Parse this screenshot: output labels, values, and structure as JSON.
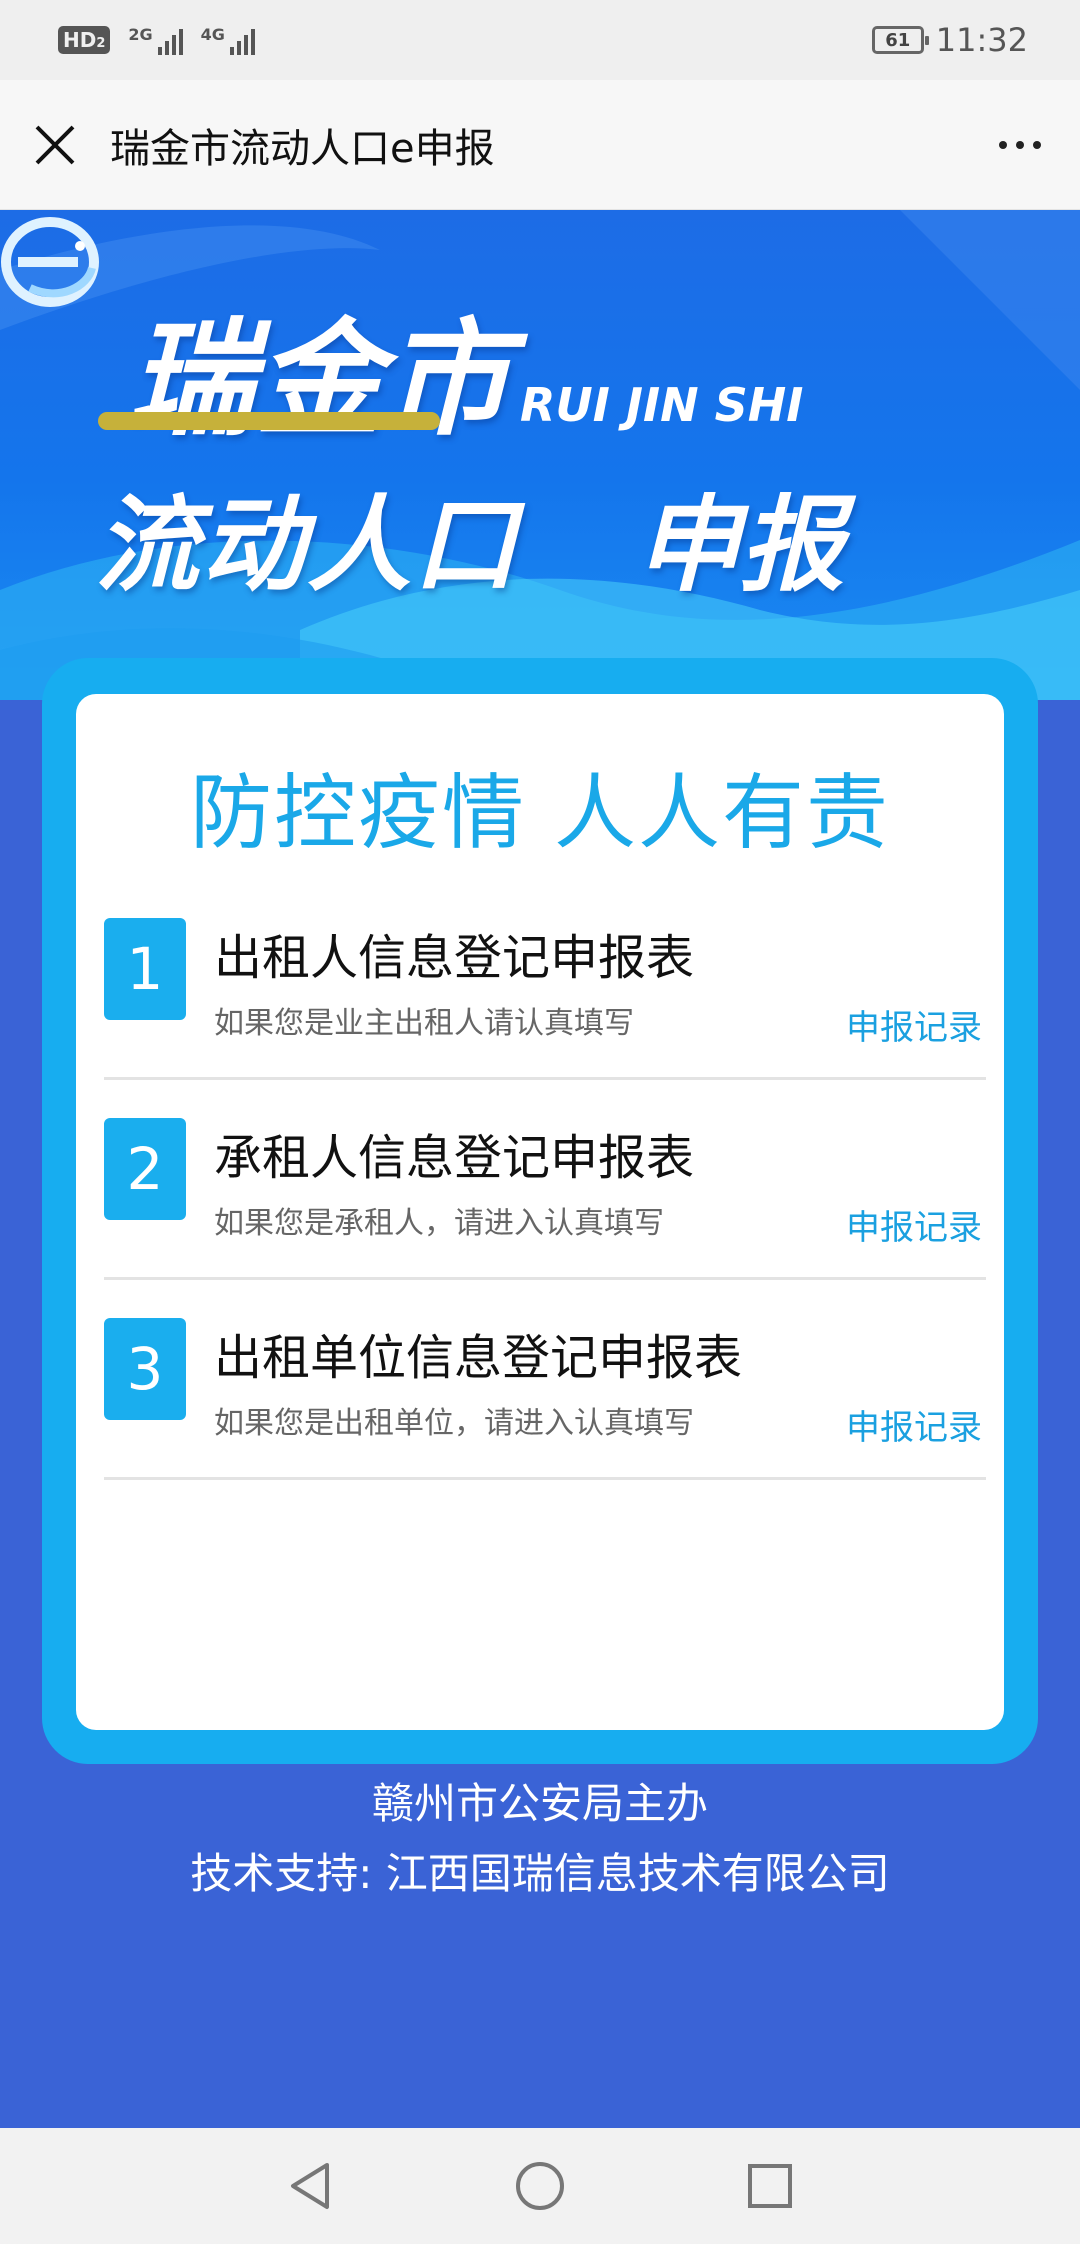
{
  "status_bar": {
    "hd_label": "HD",
    "sim_index": "2",
    "network_1": "2G",
    "network_2": "4G",
    "battery": "61",
    "time": "11:32"
  },
  "title_bar": {
    "title": "瑞金市流动人口e申报"
  },
  "banner": {
    "line1": "瑞金市",
    "subtitle": "RUI JIN SHI",
    "line2": "流动人口",
    "line3": "申报"
  },
  "card": {
    "slogan": "防控疫情 人人有责",
    "forms": [
      {
        "number": "1",
        "title": "出租人信息登记申报表",
        "desc": "如果您是业主出租人请认真填写",
        "link": "申报记录"
      },
      {
        "number": "2",
        "title": "承租人信息登记申报表",
        "desc": "如果您是承租人，请进入认真填写",
        "link": "申报记录"
      },
      {
        "number": "3",
        "title": "出租单位信息登记申报表",
        "desc": "如果您是出租单位，请进入认真填写",
        "link": "申报记录"
      }
    ]
  },
  "footer": {
    "organizer": "赣州市公安局主办",
    "support": "技术支持: 江西国瑞信息技术有限公司"
  },
  "colors": {
    "page_background": "#3a63d6",
    "card_frame": "#17adf0",
    "accent": "#1aa8e8",
    "number_box": "#1aaeee",
    "banner_underline": "#c6b13a"
  },
  "icons": {
    "close": "close-icon",
    "more": "more-icon",
    "back": "back-icon",
    "home": "home-icon",
    "recents": "recents-icon"
  }
}
